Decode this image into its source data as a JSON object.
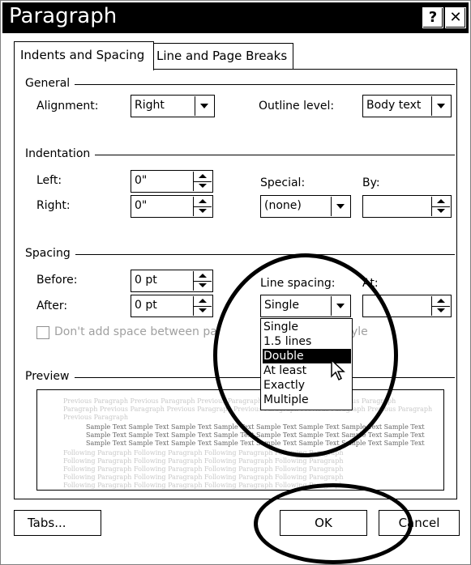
{
  "window": {
    "title": "Paragraph",
    "help_button": "?",
    "close_button": "✕"
  },
  "tabs": [
    {
      "label": "Indents and Spacing",
      "active": true
    },
    {
      "label": "Line and Page Breaks",
      "active": false
    }
  ],
  "general": {
    "heading": "General",
    "alignment_label": "Alignment:",
    "alignment_value": "Right",
    "outline_label": "Outline level:",
    "outline_value": "Body text"
  },
  "indentation": {
    "heading": "Indentation",
    "left_label": "Left:",
    "left_value": "0\"",
    "right_label": "Right:",
    "right_value": "0\"",
    "special_label": "Special:",
    "special_value": "(none)",
    "by_label": "By:",
    "by_value": ""
  },
  "spacing": {
    "heading": "Spacing",
    "before_label": "Before:",
    "before_value": "0 pt",
    "after_label": "After:",
    "after_value": "0 pt",
    "line_spacing_label": "Line spacing:",
    "line_spacing_value": "Single",
    "at_label": "At:",
    "at_value": "",
    "dont_add_label": "Don't add space between paragraphs of the same style",
    "dont_add_visible_left": "Don't add space between pa",
    "dont_add_visible_mid": "ragraph",
    "dont_add_visible_right": "yle"
  },
  "line_spacing_options": [
    "Single",
    "1.5 lines",
    "Double",
    "At least",
    "Exactly",
    "Multiple"
  ],
  "line_spacing_highlighted": "Double",
  "preview": {
    "heading": "Preview",
    "previous_text": "Previous Paragraph Previous Paragraph Previous Paragraph Previous Paragraph Previous Paragraph",
    "previous_line2": "Paragraph Previous Paragraph Previous Paragraph Previous Paragraph Previous Paragraph Previous Paragraph",
    "previous_line3": "Previous Paragraph",
    "sample_text": "Sample Text Sample Text Sample Text Sample Text Sample Text Sample Text Sample Text Sample Text",
    "following_text": "Following Paragraph Following Paragraph Following Paragraph Following Paragraph"
  },
  "buttons": {
    "tabs": "Tabs...",
    "ok": "OK",
    "cancel": "Cancel"
  }
}
